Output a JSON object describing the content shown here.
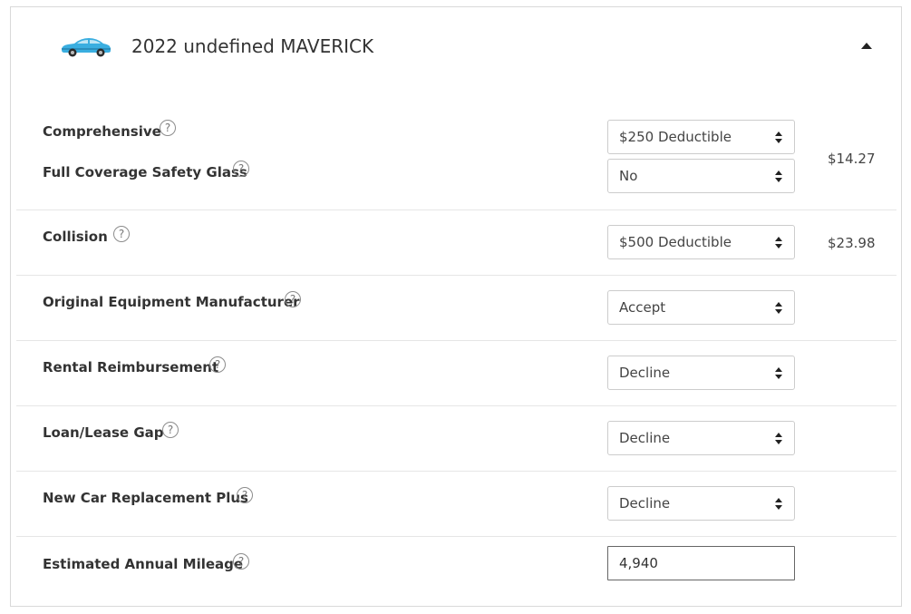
{
  "vehicle": {
    "title": "2022 undefined MAVERICK",
    "icon": "car-icon",
    "accent_color": "#3aaee0"
  },
  "coverages": {
    "comprehensive": {
      "label": "Comprehensive",
      "value": "$250 Deductible"
    },
    "safety_glass": {
      "label": "Full Coverage Safety Glass",
      "value": "No"
    },
    "comprehensive_price": "$14.27",
    "collision": {
      "label": "Collision",
      "value": "$500 Deductible",
      "price": "$23.98"
    },
    "oem": {
      "label": "Original Equipment Manufacturer",
      "value": "Accept"
    },
    "rental": {
      "label": "Rental Reimbursement",
      "value": "Decline"
    },
    "gap": {
      "label": "Loan/Lease Gap",
      "value": "Decline"
    },
    "new_car": {
      "label": "New Car Replacement Plus",
      "value": "Decline"
    },
    "mileage": {
      "label": "Estimated Annual Mileage",
      "value": "4,940"
    }
  },
  "help_glyph": "?"
}
